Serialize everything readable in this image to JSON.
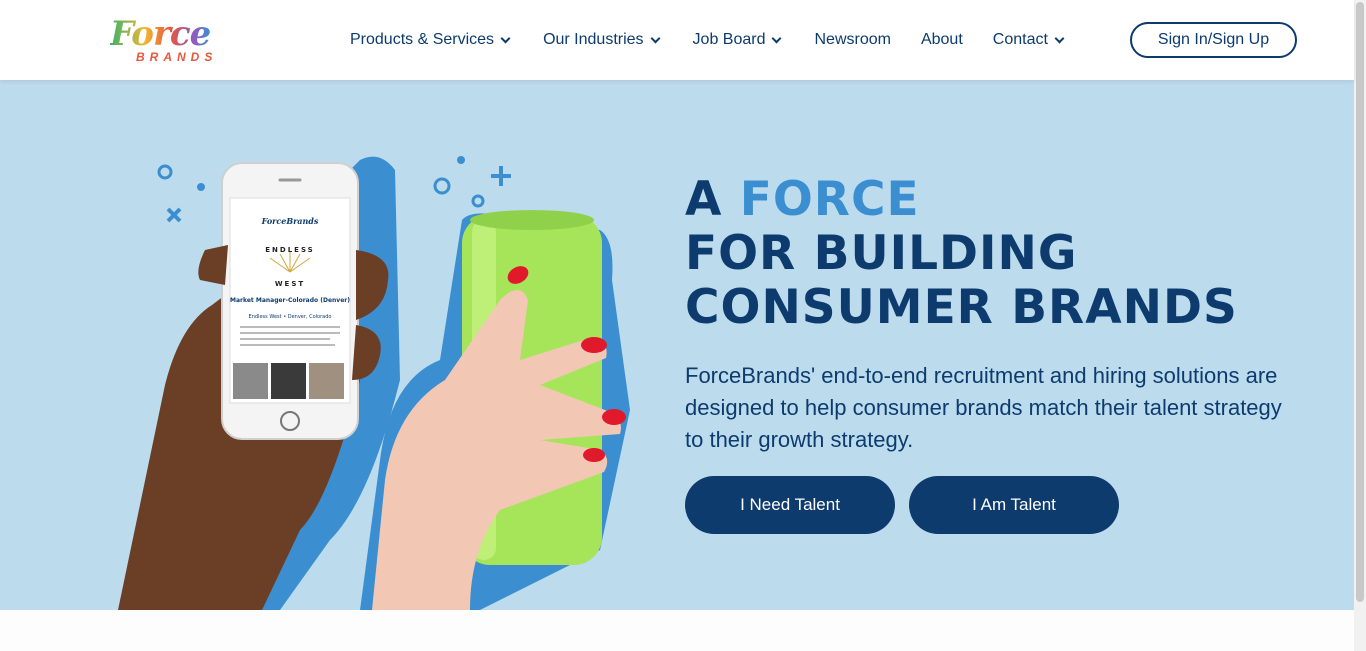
{
  "brand": {
    "logo_word": "Force",
    "logo_sub": "BRANDS"
  },
  "nav": {
    "items": [
      {
        "label": "Products & Services",
        "dropdown": true
      },
      {
        "label": "Our Industries",
        "dropdown": true
      },
      {
        "label": "Job Board",
        "dropdown": true
      },
      {
        "label": "Newsroom",
        "dropdown": false
      },
      {
        "label": "About",
        "dropdown": false
      },
      {
        "label": "Contact",
        "dropdown": true
      }
    ],
    "signin_label": "Sign In/Sign Up"
  },
  "hero": {
    "headline_a": "A ",
    "headline_accent": "FORCE",
    "headline_line2": "FOR BUILDING",
    "headline_line3": "CONSUMER BRANDS",
    "subtext": "ForceBrands' end-to-end recruitment and hiring solutions are designed to help consumer brands match their talent strategy to their growth strategy.",
    "cta_primary": "I Need Talent",
    "cta_secondary": "I Am Talent",
    "phone": {
      "app_name": "ForceBrands",
      "company_line1": "ENDLESS",
      "company_line2": "WEST",
      "job_title": "Market Manager-Colorado (Denver)",
      "job_meta": "Endless West • Denver, Colorado"
    }
  },
  "colors": {
    "navy": "#0d3b6e",
    "accent_blue": "#3b8fd0",
    "hero_bg": "#bcdcee",
    "can_green": "#a6e45a",
    "nail_red": "#e0192b"
  }
}
